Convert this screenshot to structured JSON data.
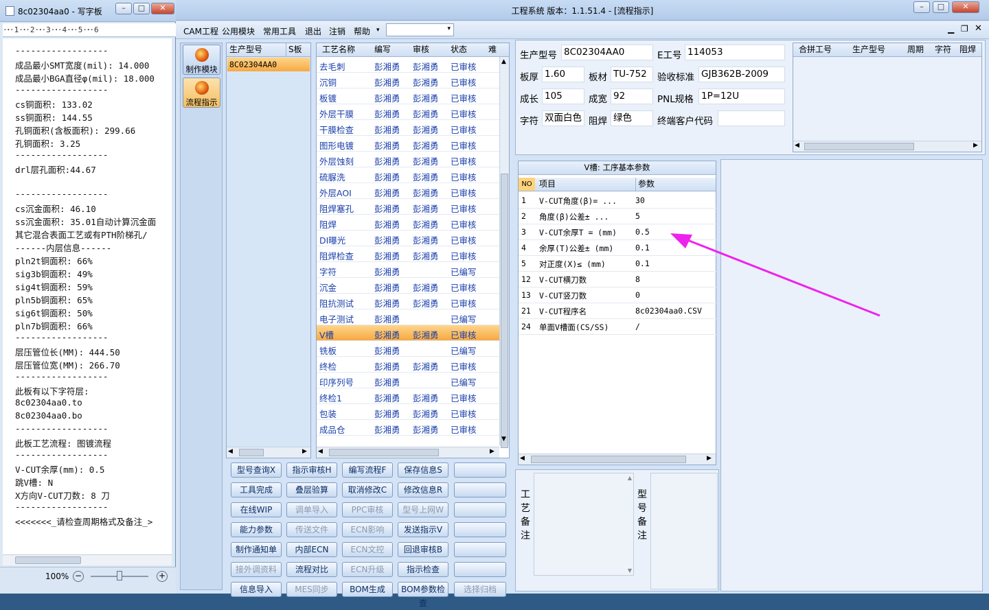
{
  "wordpad": {
    "title": "8c02304aa0 - 写字板",
    "ruler": "·ꞏ·1·ꞏ·2·ꞏ·3·ꞏ·4·ꞏ·5·ꞏ·6",
    "lines": [
      "------------------",
      "成品最小SMT宽度(mil): 14.000",
      "成品最小BGA直径φ(mil): 18.000",
      "------------------",
      "cs铜面积: 133.02",
      "ss铜面积: 144.55",
      "孔铜面积(含板面积): 299.66",
      "孔铜面积: 3.25",
      "------------------",
      "drl层孔面积:44.67",
      "",
      "------------------",
      "cs沉金面积: 46.10",
      "ss沉金面积: 35.01自动计算沉金面",
      "其它混合表面工艺或有PTH阶梯孔/",
      "------内层信息------",
      "pln2t铜面积: 66%",
      "sig3b铜面积: 49%",
      "sig4t铜面积: 59%",
      "pln5b铜面积: 65%",
      "sig6t铜面积: 50%",
      "pln7b铜面积: 66%",
      "------------------",
      "层压管位长(MM): 444.50",
      "层压管位宽(MM): 266.70",
      "------------------",
      "此板有以下字符层:",
      "8c02304aa0.to",
      "8c02304aa0.bo",
      "------------------",
      "此板工艺流程: 图镀流程",
      "------------------",
      "V-CUT余厚(mm): 0.5",
      "跳V槽: N",
      "X方向V-CUT刀数: 8 刀",
      "------------------",
      "<<<<<<<_请检查周期格式及备注_>"
    ],
    "zoom": "100%"
  },
  "main": {
    "title": "工程系统   版本：1.1.51.4 - [流程指示]",
    "menu": [
      "CAM工程",
      "公用模块",
      "常用工具",
      "退出",
      "注销",
      "帮助"
    ],
    "nav": [
      "制作模块",
      "流程指示"
    ],
    "models": {
      "headers": [
        "生产型号",
        "S板"
      ],
      "rows": [
        "8C02304AA0"
      ]
    },
    "process": {
      "headers": [
        "工艺名称",
        "编写",
        "审核",
        "状态",
        "难"
      ],
      "rows": [
        [
          "去毛刺",
          "彭湘勇",
          "彭湘勇",
          "已审核"
        ],
        [
          "沉铜",
          "彭湘勇",
          "彭湘勇",
          "已审核"
        ],
        [
          "板镀",
          "彭湘勇",
          "彭湘勇",
          "已审核"
        ],
        [
          "外层干膜",
          "彭湘勇",
          "彭湘勇",
          "已审核"
        ],
        [
          "干膜检查",
          "彭湘勇",
          "彭湘勇",
          "已审核"
        ],
        [
          "图形电镀",
          "彭湘勇",
          "彭湘勇",
          "已审核"
        ],
        [
          "外层蚀刻",
          "彭湘勇",
          "彭湘勇",
          "已审核"
        ],
        [
          "硫脲洗",
          "彭湘勇",
          "彭湘勇",
          "已审核"
        ],
        [
          "外层AOI",
          "彭湘勇",
          "彭湘勇",
          "已审核"
        ],
        [
          "阻焊塞孔",
          "彭湘勇",
          "彭湘勇",
          "已审核"
        ],
        [
          "阻焊",
          "彭湘勇",
          "彭湘勇",
          "已审核"
        ],
        [
          "DI曝光",
          "彭湘勇",
          "彭湘勇",
          "已审核"
        ],
        [
          "阻焊检查",
          "彭湘勇",
          "彭湘勇",
          "已审核"
        ],
        [
          "字符",
          "彭湘勇",
          "",
          "已编写"
        ],
        [
          "沉金",
          "彭湘勇",
          "彭湘勇",
          "已审核"
        ],
        [
          "阻抗测试",
          "彭湘勇",
          "彭湘勇",
          "已审核"
        ],
        [
          "电子测试",
          "彭湘勇",
          "",
          "已编写"
        ],
        [
          "V槽",
          "彭湘勇",
          "彭湘勇",
          "已审核"
        ],
        [
          "铣板",
          "彭湘勇",
          "",
          "已编写"
        ],
        [
          "终检",
          "彭湘勇",
          "彭湘勇",
          "已审核"
        ],
        [
          "印序列号",
          "彭湘勇",
          "",
          "已编写"
        ],
        [
          "终检1",
          "彭湘勇",
          "彭湘勇",
          "已审核"
        ],
        [
          "包装",
          "彭湘勇",
          "彭湘勇",
          "已审核"
        ],
        [
          "成品仓",
          "彭湘勇",
          "彭湘勇",
          "已审核"
        ]
      ],
      "selected_index": 17
    },
    "buttons": [
      [
        "型号查询X",
        "指示审核H",
        "编写流程F",
        "保存信息S",
        ""
      ],
      [
        "工具完成",
        "叠层验算",
        "取消修改C",
        "修改信息R",
        ""
      ],
      [
        "在线WIP",
        "调单导入",
        "PPC审核",
        "型号上网W",
        ""
      ],
      [
        "能力参数",
        "传送文件",
        "ECN影响",
        "发送指示V",
        ""
      ],
      [
        "制作通知单",
        "内部ECN",
        "ECN文控",
        "回退审核B",
        ""
      ],
      [
        "接外调资料",
        "流程对比",
        "ECN升级",
        "指示检查",
        ""
      ],
      [
        "信息导入",
        "MES同步",
        "BOM生成",
        "BOM参数检查",
        "选择归档"
      ]
    ],
    "buttons_disabled": [
      [],
      [],
      [
        1,
        2,
        3
      ],
      [
        1,
        2
      ],
      [
        2
      ],
      [
        0,
        2
      ],
      [
        1,
        4
      ]
    ],
    "info": {
      "fields": [
        {
          "label": "生产型号",
          "value": "8C02304AA0"
        },
        {
          "label": "E工号",
          "value": "114053"
        },
        {
          "label": "板厚",
          "value": "1.60"
        },
        {
          "label": "板材",
          "value": "TU-752"
        },
        {
          "label": "验收标准",
          "value": "GJB362B-2009"
        },
        {
          "label": "成长",
          "value": "105"
        },
        {
          "label": "成宽",
          "value": "92"
        },
        {
          "label": "PNL规格",
          "value": "1P=12U"
        },
        {
          "label": "字符",
          "value": "双面白色"
        },
        {
          "label": "阻焊",
          "value": "绿色"
        },
        {
          "label": "终端客户代码",
          "value": ""
        }
      ]
    },
    "merge": {
      "headers": [
        "合拼工号",
        "生产型号",
        "周期",
        "字符",
        "阻焊"
      ]
    },
    "vcut": {
      "title": "V槽: 工序基本参数",
      "headers": [
        "NO",
        "项目",
        "参数"
      ],
      "rows": [
        [
          "1",
          "V-CUT角度(β)=  ...",
          "30"
        ],
        [
          "2",
          "角度(β)公差±  ...",
          "5"
        ],
        [
          "3",
          "V-CUT余厚T =  (mm)",
          "0.5"
        ],
        [
          "4",
          "余厚(T)公差±  (mm)",
          "0.1"
        ],
        [
          "5",
          "对正度(X)≤ (mm)",
          "0.1"
        ],
        [
          "12",
          "V-CUT横刀数",
          "8"
        ],
        [
          "13",
          "V-CUT竖刀数",
          "0"
        ],
        [
          "21",
          "V-CUT程序名",
          "8c02304aa0.CSV"
        ],
        [
          "24",
          "单面V槽面(CS/SS)",
          "/"
        ]
      ]
    },
    "remarks": {
      "process_label": "工艺备注",
      "model_label": "型号备注"
    },
    "annotation": {
      "color": "#ee22ee"
    }
  }
}
